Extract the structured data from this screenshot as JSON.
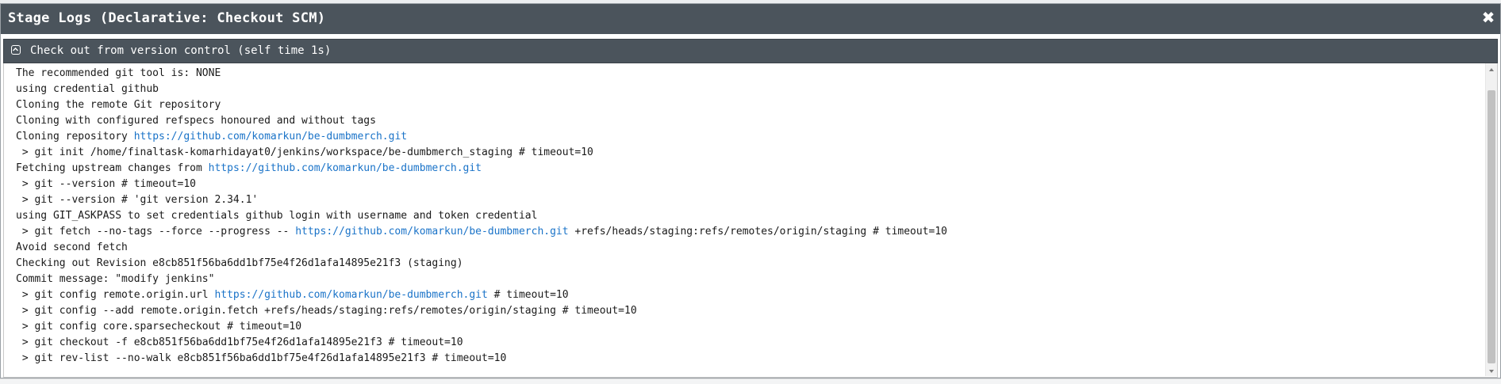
{
  "modal": {
    "title": "Stage Logs (Declarative: Checkout SCM)",
    "close_label": "✖"
  },
  "step": {
    "label": "Check out from version control (self time 1s)",
    "toggle_icon": "collapse-icon"
  },
  "log": {
    "lines": [
      [
        {
          "text": "The recommended git tool is: NONE"
        }
      ],
      [
        {
          "text": "using credential github"
        }
      ],
      [
        {
          "text": "Cloning the remote Git repository"
        }
      ],
      [
        {
          "text": "Cloning with configured refspecs honoured and without tags"
        }
      ],
      [
        {
          "text": "Cloning repository "
        },
        {
          "text": "https://github.com/komarkun/be-dumbmerch.git",
          "link": true
        }
      ],
      [
        {
          "text": " > git init /home/finaltask-komarhidayat0/jenkins/workspace/be-dumbmerch_staging # timeout=10"
        }
      ],
      [
        {
          "text": "Fetching upstream changes from "
        },
        {
          "text": "https://github.com/komarkun/be-dumbmerch.git",
          "link": true
        }
      ],
      [
        {
          "text": " > git --version # timeout=10"
        }
      ],
      [
        {
          "text": " > git --version # 'git version 2.34.1'"
        }
      ],
      [
        {
          "text": "using GIT_ASKPASS to set credentials github login with username and token credential"
        }
      ],
      [
        {
          "text": " > git fetch --no-tags --force --progress -- "
        },
        {
          "text": "https://github.com/komarkun/be-dumbmerch.git",
          "link": true
        },
        {
          "text": " +refs/heads/staging:refs/remotes/origin/staging # timeout=10"
        }
      ],
      [
        {
          "text": "Avoid second fetch"
        }
      ],
      [
        {
          "text": "Checking out Revision e8cb851f56ba6dd1bf75e4f26d1afa14895e21f3 (staging)"
        }
      ],
      [
        {
          "text": "Commit message: \"modify jenkins\""
        }
      ],
      [
        {
          "text": " > git config remote.origin.url "
        },
        {
          "text": "https://github.com/komarkun/be-dumbmerch.git",
          "link": true
        },
        {
          "text": " # timeout=10"
        }
      ],
      [
        {
          "text": " > git config --add remote.origin.fetch +refs/heads/staging:refs/remotes/origin/staging # timeout=10"
        }
      ],
      [
        {
          "text": " > git config core.sparsecheckout # timeout=10"
        }
      ],
      [
        {
          "text": " > git checkout -f e8cb851f56ba6dd1bf75e4f26d1afa14895e21f3 # timeout=10"
        }
      ],
      [
        {
          "text": " > git rev-list --no-walk e8cb851f56ba6dd1bf75e4f26d1afa14895e21f3 # timeout=10"
        }
      ]
    ]
  },
  "colors": {
    "header_bg": "#4b545c",
    "link": "#1a73c8",
    "text": "#1a1a1a"
  }
}
